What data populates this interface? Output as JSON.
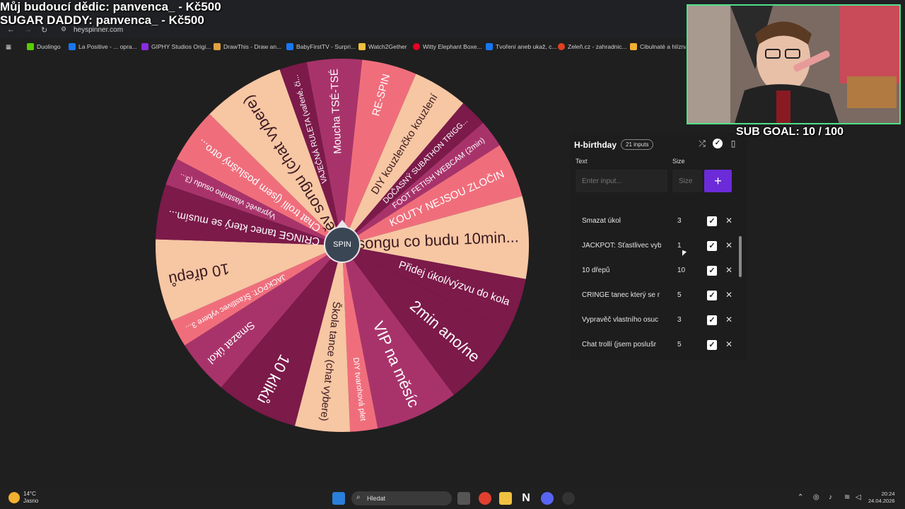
{
  "overlay": {
    "line1": "Můj budoucí dědic: panvenca_ - Kč500",
    "line2": "SUGAR DADDY: panvenca_ - Kč500"
  },
  "browser": {
    "url": "heyspinner.com",
    "bookmarks": [
      {
        "label": "Duolingo",
        "color": "#58cc02"
      },
      {
        "label": "La Positive - ... opra...",
        "color": "#1877f2"
      },
      {
        "label": "GIPHY Studios Origi...",
        "color": "#8a2be2"
      },
      {
        "label": "DrawThis - Draw an...",
        "color": "#e0a040"
      },
      {
        "label": "BabyFirstTV - Surpri...",
        "color": "#1877f2"
      },
      {
        "label": "Watch2Gether",
        "color": "#f0c040"
      },
      {
        "label": "Witty Elephant Boxe...",
        "color": "#e60023"
      },
      {
        "label": "Tvoření aneb ukaž, c...",
        "color": "#1877f2"
      },
      {
        "label": "Zeleň.cz - zahradnic...",
        "color": "#e04020"
      },
      {
        "label": "Cibulnaté a hlíznat...",
        "color": "#f0b030"
      }
    ]
  },
  "wheel": {
    "spin_label": "SPIN",
    "colors": {
      "peach": "#f7c6a3",
      "salmon": "#f06e7c",
      "mauve": "#a8336b",
      "wine": "#7c1a4a"
    },
    "segments": [
      {
        "label": "Moucha TSÉ-TSÉ",
        "color": "#a8336b",
        "weight": 2
      },
      {
        "label": "RE-SPIN",
        "color": "#f06e7c",
        "weight": 2
      },
      {
        "label": "DIY kouzlenčko kouzlení",
        "color": "#f7c6a3",
        "weight": 2
      },
      {
        "label": "DOČASNÝ SUBATHON TRIGG...",
        "color": "#7c1a4a",
        "weight": 1
      },
      {
        "label": "FOOT FETISH WEBCAM (2min)",
        "color": "#a8336b",
        "weight": 1
      },
      {
        "label": "KOUTY NEJSOU ZLOČIN",
        "color": "#f06e7c",
        "weight": 2
      },
      {
        "label": "Vyber songu co budu 10min...",
        "color": "#f7c6a3",
        "weight": 3
      },
      {
        "label": "Přidej úkol/výzvu do kola",
        "color": "#7c1a4a",
        "weight": 2
      },
      {
        "label": "2min ano/ne",
        "color": "#7c1a4a",
        "weight": 3
      },
      {
        "label": "VIP na měsíc",
        "color": "#a8336b",
        "weight": 3
      },
      {
        "label": "DIY tvarohová plet",
        "color": "#f06e7c",
        "weight": 1
      },
      {
        "label": "Škola tance (chat vybere)",
        "color": "#f7c6a3",
        "weight": 2
      },
      {
        "label": "10 kliků",
        "color": "#7c1a4a",
        "weight": 3
      },
      {
        "label": "Smazat úkol",
        "color": "#a8336b",
        "weight": 2
      },
      {
        "label": "JACKPOT: Šťastlivec vybere 3...",
        "color": "#f06e7c",
        "weight": 1
      },
      {
        "label": "10 dřepů",
        "color": "#f7c6a3",
        "weight": 3
      },
      {
        "label": "CRINGE tanec který se musím...",
        "color": "#7c1a4a",
        "weight": 2
      },
      {
        "label": "Vypravěč vlastního osudu (3...",
        "color": "#a8336b",
        "weight": 1
      },
      {
        "label": "Chat trollí (jsem poslušný otro...",
        "color": "#f06e7c",
        "weight": 2
      },
      {
        "label": "Zpěv songu (chat vybere)",
        "color": "#f7c6a3",
        "weight": 3
      },
      {
        "label": "VAJEČNÁ RULETA (vařené, či...",
        "color": "#7c1a4a",
        "weight": 1
      }
    ]
  },
  "panel": {
    "title": "H-birthday",
    "inputs_badge": "21 inputs",
    "col_text": "Text",
    "col_size": "Size",
    "text_placeholder": "Enter input...",
    "size_placeholder": "Size",
    "add_label": "+",
    "rows": [
      {
        "label": "Smazat úkol",
        "size": "3"
      },
      {
        "label": "JACKPOT: Šťastlivec vyb",
        "size": "1"
      },
      {
        "label": "10 dřepů",
        "size": "10"
      },
      {
        "label": "CRINGE tanec který se r",
        "size": "5"
      },
      {
        "label": "Vypravěč vlastního osuc",
        "size": "3"
      },
      {
        "label": "Chat trollí (jsem poslušr",
        "size": "5"
      }
    ]
  },
  "stream": {
    "sub_goal": "SUB GOAL: 10 / 100"
  },
  "taskbar": {
    "weather_temp": "14°C",
    "weather_desc": "Jasno",
    "search_placeholder": "Hledat",
    "time": "20:24",
    "date": "24.04.2026"
  }
}
